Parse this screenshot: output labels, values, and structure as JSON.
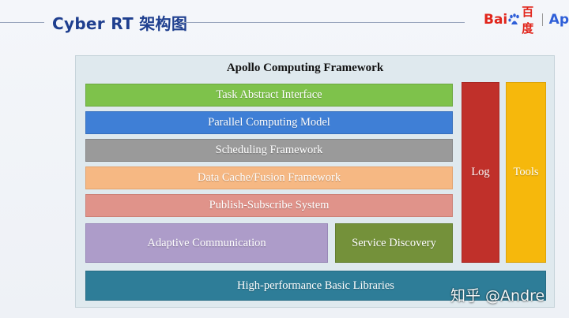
{
  "header": {
    "title": "Cyber RT 架构图"
  },
  "logo": {
    "bai": "Bai",
    "du": "百度",
    "partial": "Ap"
  },
  "diagram": {
    "title": "Apollo Computing Framework",
    "layers": {
      "task_abstract_interface": "Task Abstract Interface",
      "parallel_computing_model": "Parallel Computing Model",
      "scheduling_framework": "Scheduling Framework",
      "data_cache_fusion": "Data Cache/Fusion Framework",
      "publish_subscribe": "Publish-Subscribe System",
      "adaptive_communication": "Adaptive Communication",
      "service_discovery": "Service Discovery",
      "basic_libraries": "High-performance Basic Libraries"
    },
    "side": {
      "log": "Log",
      "tools": "Tools"
    }
  },
  "watermark": {
    "text": "知乎 @Andre"
  },
  "colors": {
    "title_blue": "#1f3f8f",
    "baidu_red": "#e1251b",
    "task_green": "#7ec24b",
    "parallel_blue": "#3f7fd6",
    "sched_gray": "#9a9a9a",
    "cache_orange": "#f6b883",
    "pubsub_salmon": "#e0938a",
    "adaptive_lavender": "#ad9cc9",
    "service_olive": "#74913a",
    "libraries_teal": "#2e7d98",
    "log_red": "#c0302a",
    "tools_yellow": "#f6b80c"
  }
}
